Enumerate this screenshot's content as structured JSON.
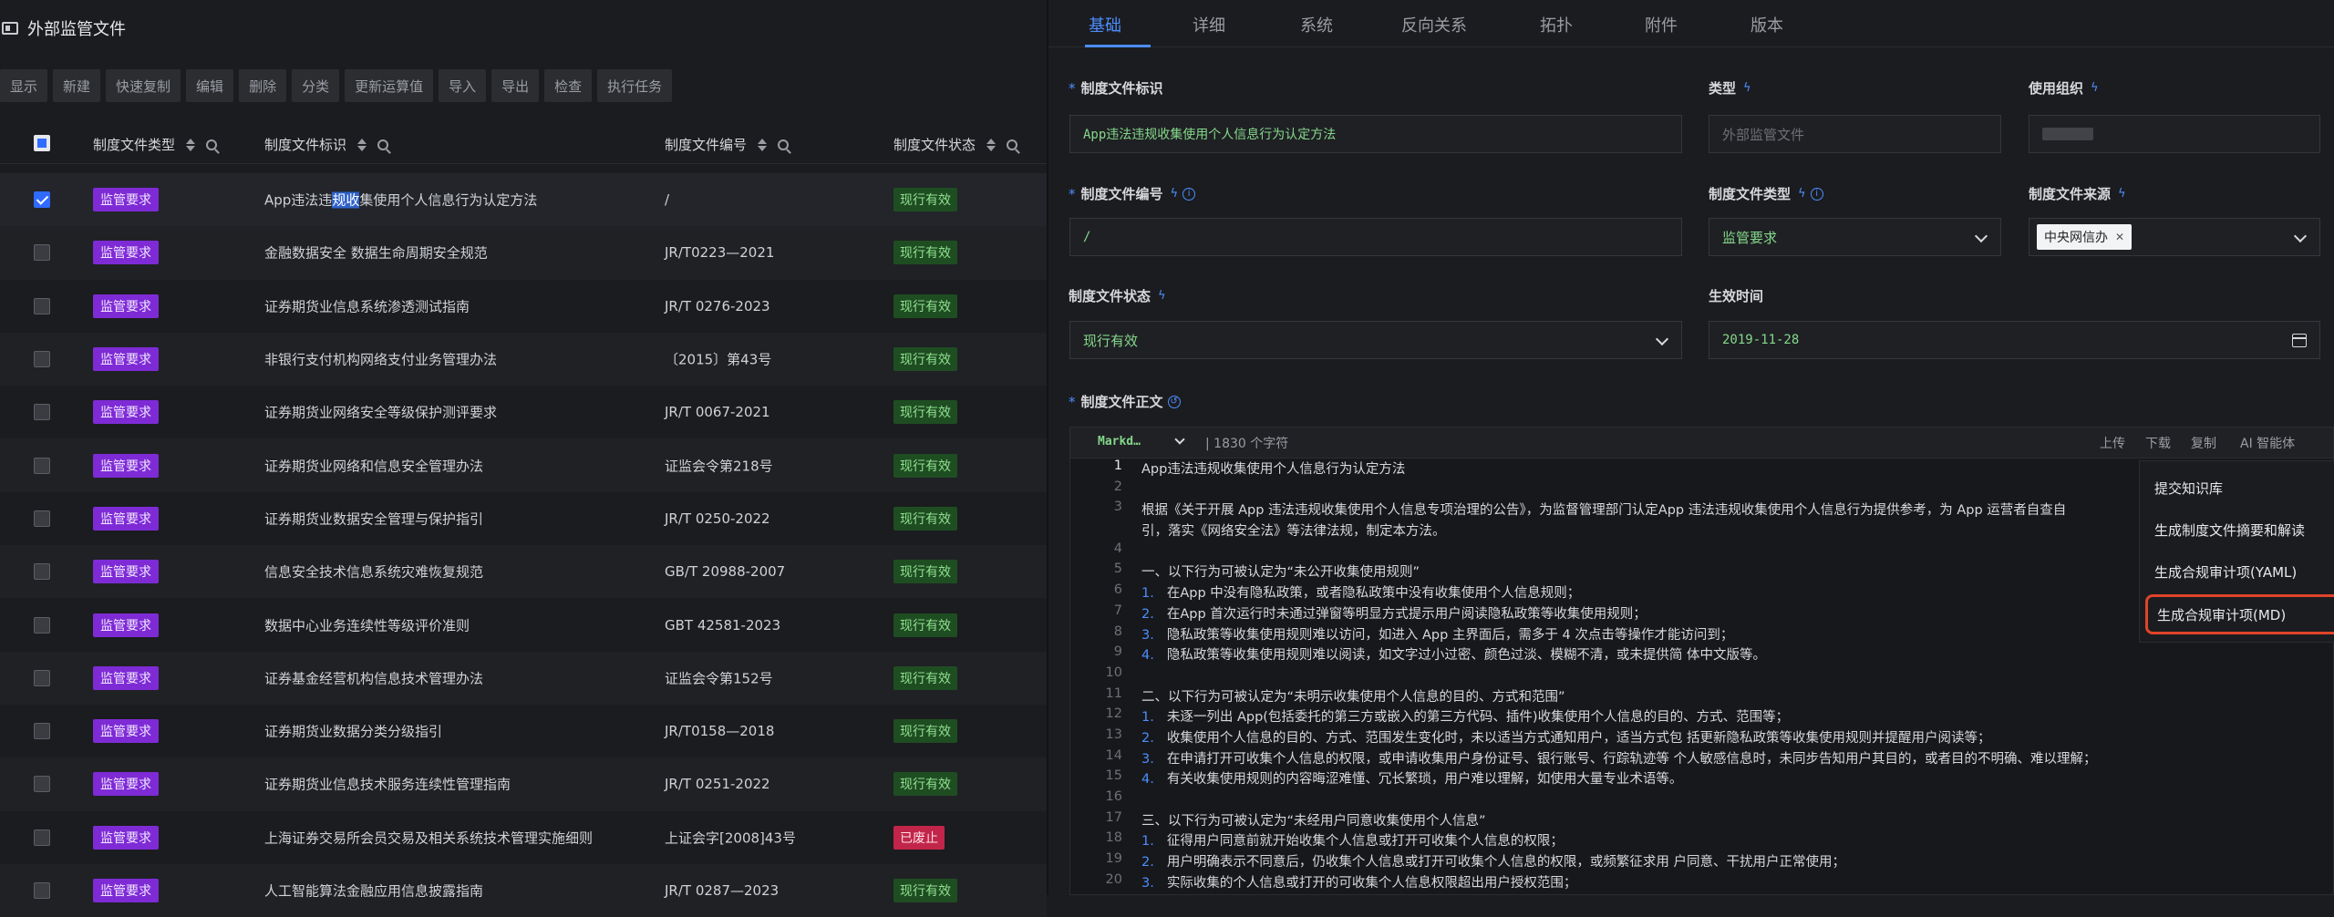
{
  "app": {
    "title": "外部监管文件"
  },
  "toolbar": [
    "显示",
    "新建",
    "快速复制",
    "编辑",
    "删除",
    "分类",
    "更新运算值",
    "导入",
    "导出",
    "检查",
    "执行任务"
  ],
  "table": {
    "columns": [
      "制度文件类型",
      "制度文件标识",
      "制度文件编号",
      "制度文件状态"
    ],
    "rows": [
      {
        "type": "监管要求",
        "name_pre": "App违法违",
        "name_hl": "规收",
        "name_post": "集使用个人信息行为认定方法",
        "no": "/",
        "status": "现行有效",
        "selected": true
      },
      {
        "type": "监管要求",
        "name": "金融数据安全 数据生命周期安全规范",
        "no": "JR/T0223—2021",
        "status": "现行有效"
      },
      {
        "type": "监管要求",
        "name": "证券期货业信息系统渗透测试指南",
        "no": "JR/T 0276-2023",
        "status": "现行有效"
      },
      {
        "type": "监管要求",
        "name": "非银行支付机构网络支付业务管理办法",
        "no": "〔2015〕第43号",
        "status": "现行有效"
      },
      {
        "type": "监管要求",
        "name": "证券期货业网络安全等级保护测评要求",
        "no": "JR/T 0067-2021",
        "status": "现行有效"
      },
      {
        "type": "监管要求",
        "name": "证券期货业网络和信息安全管理办法",
        "no": "证监会令第218号",
        "status": "现行有效"
      },
      {
        "type": "监管要求",
        "name": "证券期货业数据安全管理与保护指引",
        "no": "JR/T 0250-2022",
        "status": "现行有效"
      },
      {
        "type": "监管要求",
        "name": "信息安全技术信息系统灾难恢复规范",
        "no": "GB/T 20988-2007",
        "status": "现行有效"
      },
      {
        "type": "监管要求",
        "name": "数据中心业务连续性等级评价准则",
        "no": "GBT 42581-2023",
        "status": "现行有效"
      },
      {
        "type": "监管要求",
        "name": "证券基金经营机构信息技术管理办法",
        "no": "证监会令第152号",
        "status": "现行有效"
      },
      {
        "type": "监管要求",
        "name": "证券期货业数据分类分级指引",
        "no": "JR/T0158—2018",
        "status": "现行有效"
      },
      {
        "type": "监管要求",
        "name": "证券期货业信息技术服务连续性管理指南",
        "no": "JR/T 0251-2022",
        "status": "现行有效"
      },
      {
        "type": "监管要求",
        "name": "上海证券交易所会员交易及相关系统技术管理实施细则",
        "no": "上证会字[2008]43号",
        "status": "已废止"
      },
      {
        "type": "监管要求",
        "name": "人工智能算法金融应用信息披露指南",
        "no": "JR/T 0287—2023",
        "status": "现行有效"
      }
    ]
  },
  "tabs": [
    "基础",
    "详细",
    "系统",
    "反向关系",
    "拓扑",
    "附件",
    "版本"
  ],
  "form": {
    "id_label": "制度文件标识",
    "id_value": "App违法违规收集使用个人信息行为认定方法",
    "category_label": "类型",
    "category_value": "外部监管文件",
    "org_label": "使用组织",
    "no_label": "制度文件编号",
    "no_value": "/",
    "type_label": "制度文件类型",
    "type_value": "监管要求",
    "source_label": "制度文件来源",
    "source_value": "中央网信办",
    "status_label": "制度文件状态",
    "status_value": "现行有效",
    "date_label": "生效时间",
    "date_value": "2019-11-28",
    "body_label": "制度文件正文"
  },
  "editor": {
    "mode": "Markd…",
    "char_count": "| 1830 个字符",
    "actions": [
      "上传",
      "下载",
      "复制",
      "AI 智能体"
    ],
    "lines": [
      {
        "n": "1",
        "t": "App违法违规收集使用个人信息行为认定方法"
      },
      {
        "n": "2",
        "t": ""
      },
      {
        "n": "3",
        "t": "根据《关于开展 App 违法违规收集使用个人信息专项治理的公告》，为监督管理部门认定App 违法违规收集使用个人信息行为提供参考，为 App 运营者自查自"
      },
      {
        "n": "",
        "t": "引，落实《网络安全法》等法律法规，制定本方法。"
      },
      {
        "n": "4",
        "t": ""
      },
      {
        "n": "5",
        "t": "一、以下行为可被认定为“未公开收集使用规则”"
      },
      {
        "n": "6",
        "o": "1.",
        "t": "在App 中没有隐私政策，或者隐私政策中没有收集使用个人信息规则；"
      },
      {
        "n": "7",
        "o": "2.",
        "t": "在App 首次运行时未通过弹窗等明显方式提示用户阅读隐私政策等收集使用规则；"
      },
      {
        "n": "8",
        "o": "3.",
        "t": "隐私政策等收集使用规则难以访问，如进入 App 主界面后，需多于 4 次点击等操作才能访问到；"
      },
      {
        "n": "9",
        "o": "4.",
        "t": "隐私政策等收集使用规则难以阅读，如文字过小过密、颜色过淡、模糊不清，或未提供简 体中文版等。"
      },
      {
        "n": "10",
        "t": ""
      },
      {
        "n": "11",
        "t": "二、以下行为可被认定为“未明示收集使用个人信息的目的、方式和范围”"
      },
      {
        "n": "12",
        "o": "1.",
        "t": "未逐一列出  App(包括委托的第三方或嵌入的第三方代码、插件)收集使用个人信息的目的、方式、范围等；"
      },
      {
        "n": "13",
        "o": "2.",
        "t": "收集使用个人信息的目的、方式、范围发生变化时，未以适当方式通知用户，适当方式包 括更新隐私政策等收集使用规则并提醒用户阅读等；"
      },
      {
        "n": "14",
        "o": "3.",
        "t": "在申请打开可收集个人信息的权限，或申请收集用户身份证号、银行账号、行踪轨迹等 个人敏感信息时，未同步告知用户其目的，或者目的不明确、难以理解；"
      },
      {
        "n": "15",
        "o": "4.",
        "t": "有关收集使用规则的内容晦涩难懂、冗长繁琐，用户难以理解，如使用大量专业术语等。"
      },
      {
        "n": "16",
        "t": ""
      },
      {
        "n": "17",
        "t": "三、以下行为可被认定为“未经用户同意收集使用个人信息”"
      },
      {
        "n": "18",
        "o": "1.",
        "t": "征得用户同意前就开始收集个人信息或打开可收集个人信息的权限；"
      },
      {
        "n": "19",
        "o": "2.",
        "t": "用户明确表示不同意后，仍收集个人信息或打开可收集个人信息的权限，或频繁征求用 户同意、干扰用户正常使用；"
      },
      {
        "n": "20",
        "o": "3.",
        "t": "实际收集的个人信息或打开的可收集个人信息权限超出用户授权范围；"
      }
    ]
  },
  "ai_menu": [
    "提交知识库",
    "生成制度文件摘要和解读",
    "生成合规审计项(YAML)",
    "生成合规审计项(MD)"
  ]
}
